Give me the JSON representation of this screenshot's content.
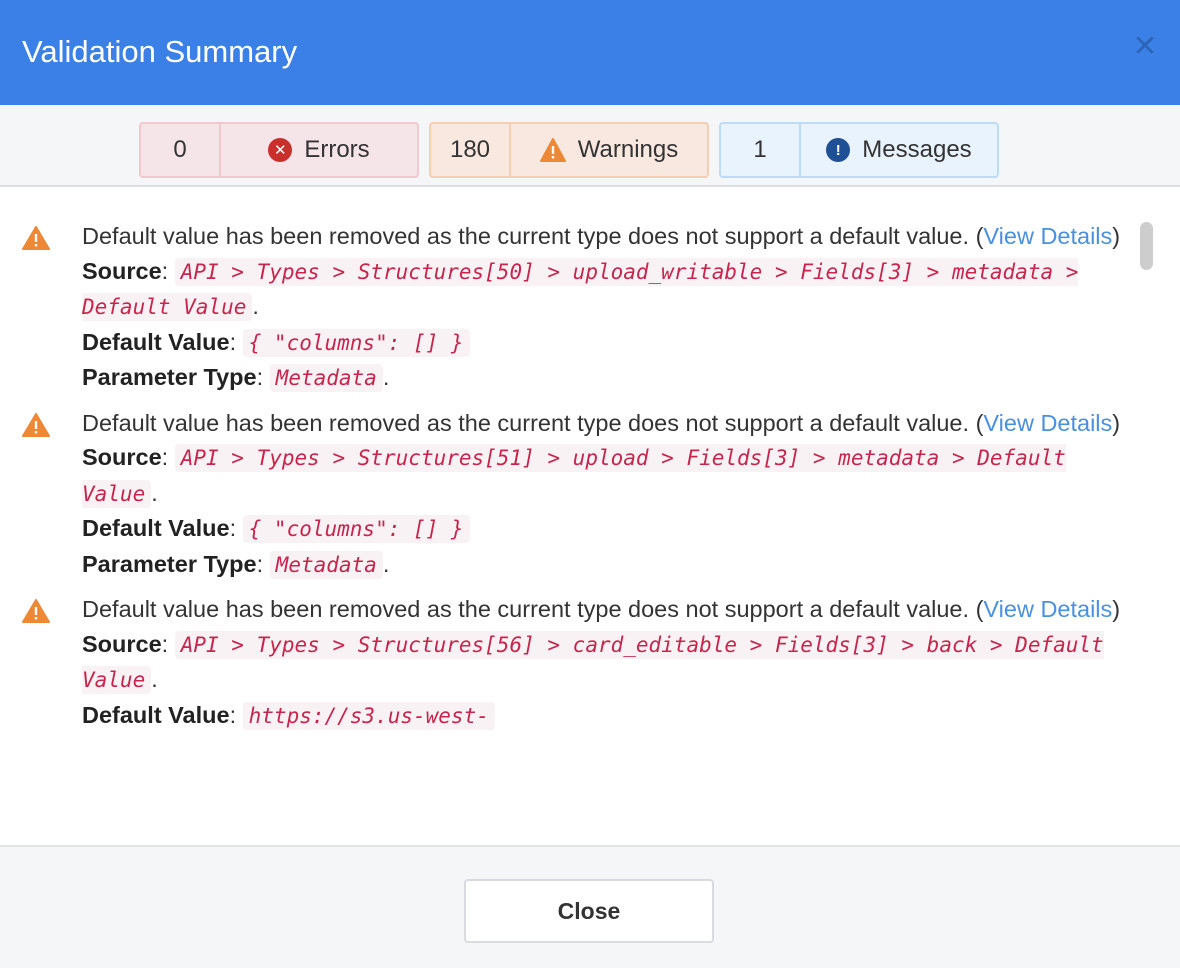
{
  "dialog": {
    "title": "Validation Summary",
    "close_icon": "close-icon"
  },
  "filters": [
    {
      "count": "0",
      "label": "Errors",
      "icon": "error-circle-icon",
      "color": "#c9302c"
    },
    {
      "count": "180",
      "label": "Warnings",
      "icon": "warning-triangle-icon",
      "color": "#ed8936"
    },
    {
      "count": "1",
      "label": "Messages",
      "icon": "info-circle-icon",
      "color": "#1f4f94"
    }
  ],
  "labels": {
    "source": "Source",
    "default_value": "Default Value",
    "parameter_type": "Parameter Type",
    "view_details": "View Details"
  },
  "items": [
    {
      "message": "Default value has been removed as the current type does not support a default value.",
      "source": "API > Types > Structures[50] > upload_writable > Fields[3] > metadata > Default Value",
      "default_value": "{ \"columns\": [] }",
      "parameter_type": "Metadata"
    },
    {
      "message": "Default value has been removed as the current type does not support a default value.",
      "source": "API > Types > Structures[51] > upload > Fields[3] > metadata > Default Value",
      "default_value": "{ \"columns\": [] }",
      "parameter_type": "Metadata"
    },
    {
      "message": "Default value has been removed as the current type does not support a default value.",
      "source": "API > Types > Structures[56] > card_editable > Fields[3] > back > Default Value",
      "default_value": "https://s3.us-west-",
      "parameter_type": ""
    }
  ],
  "footer": {
    "close_label": "Close"
  },
  "colors": {
    "header": "#3b80e6",
    "link": "#4a90e2",
    "code": "#c7254e",
    "code_bg": "#f9f2f4"
  }
}
